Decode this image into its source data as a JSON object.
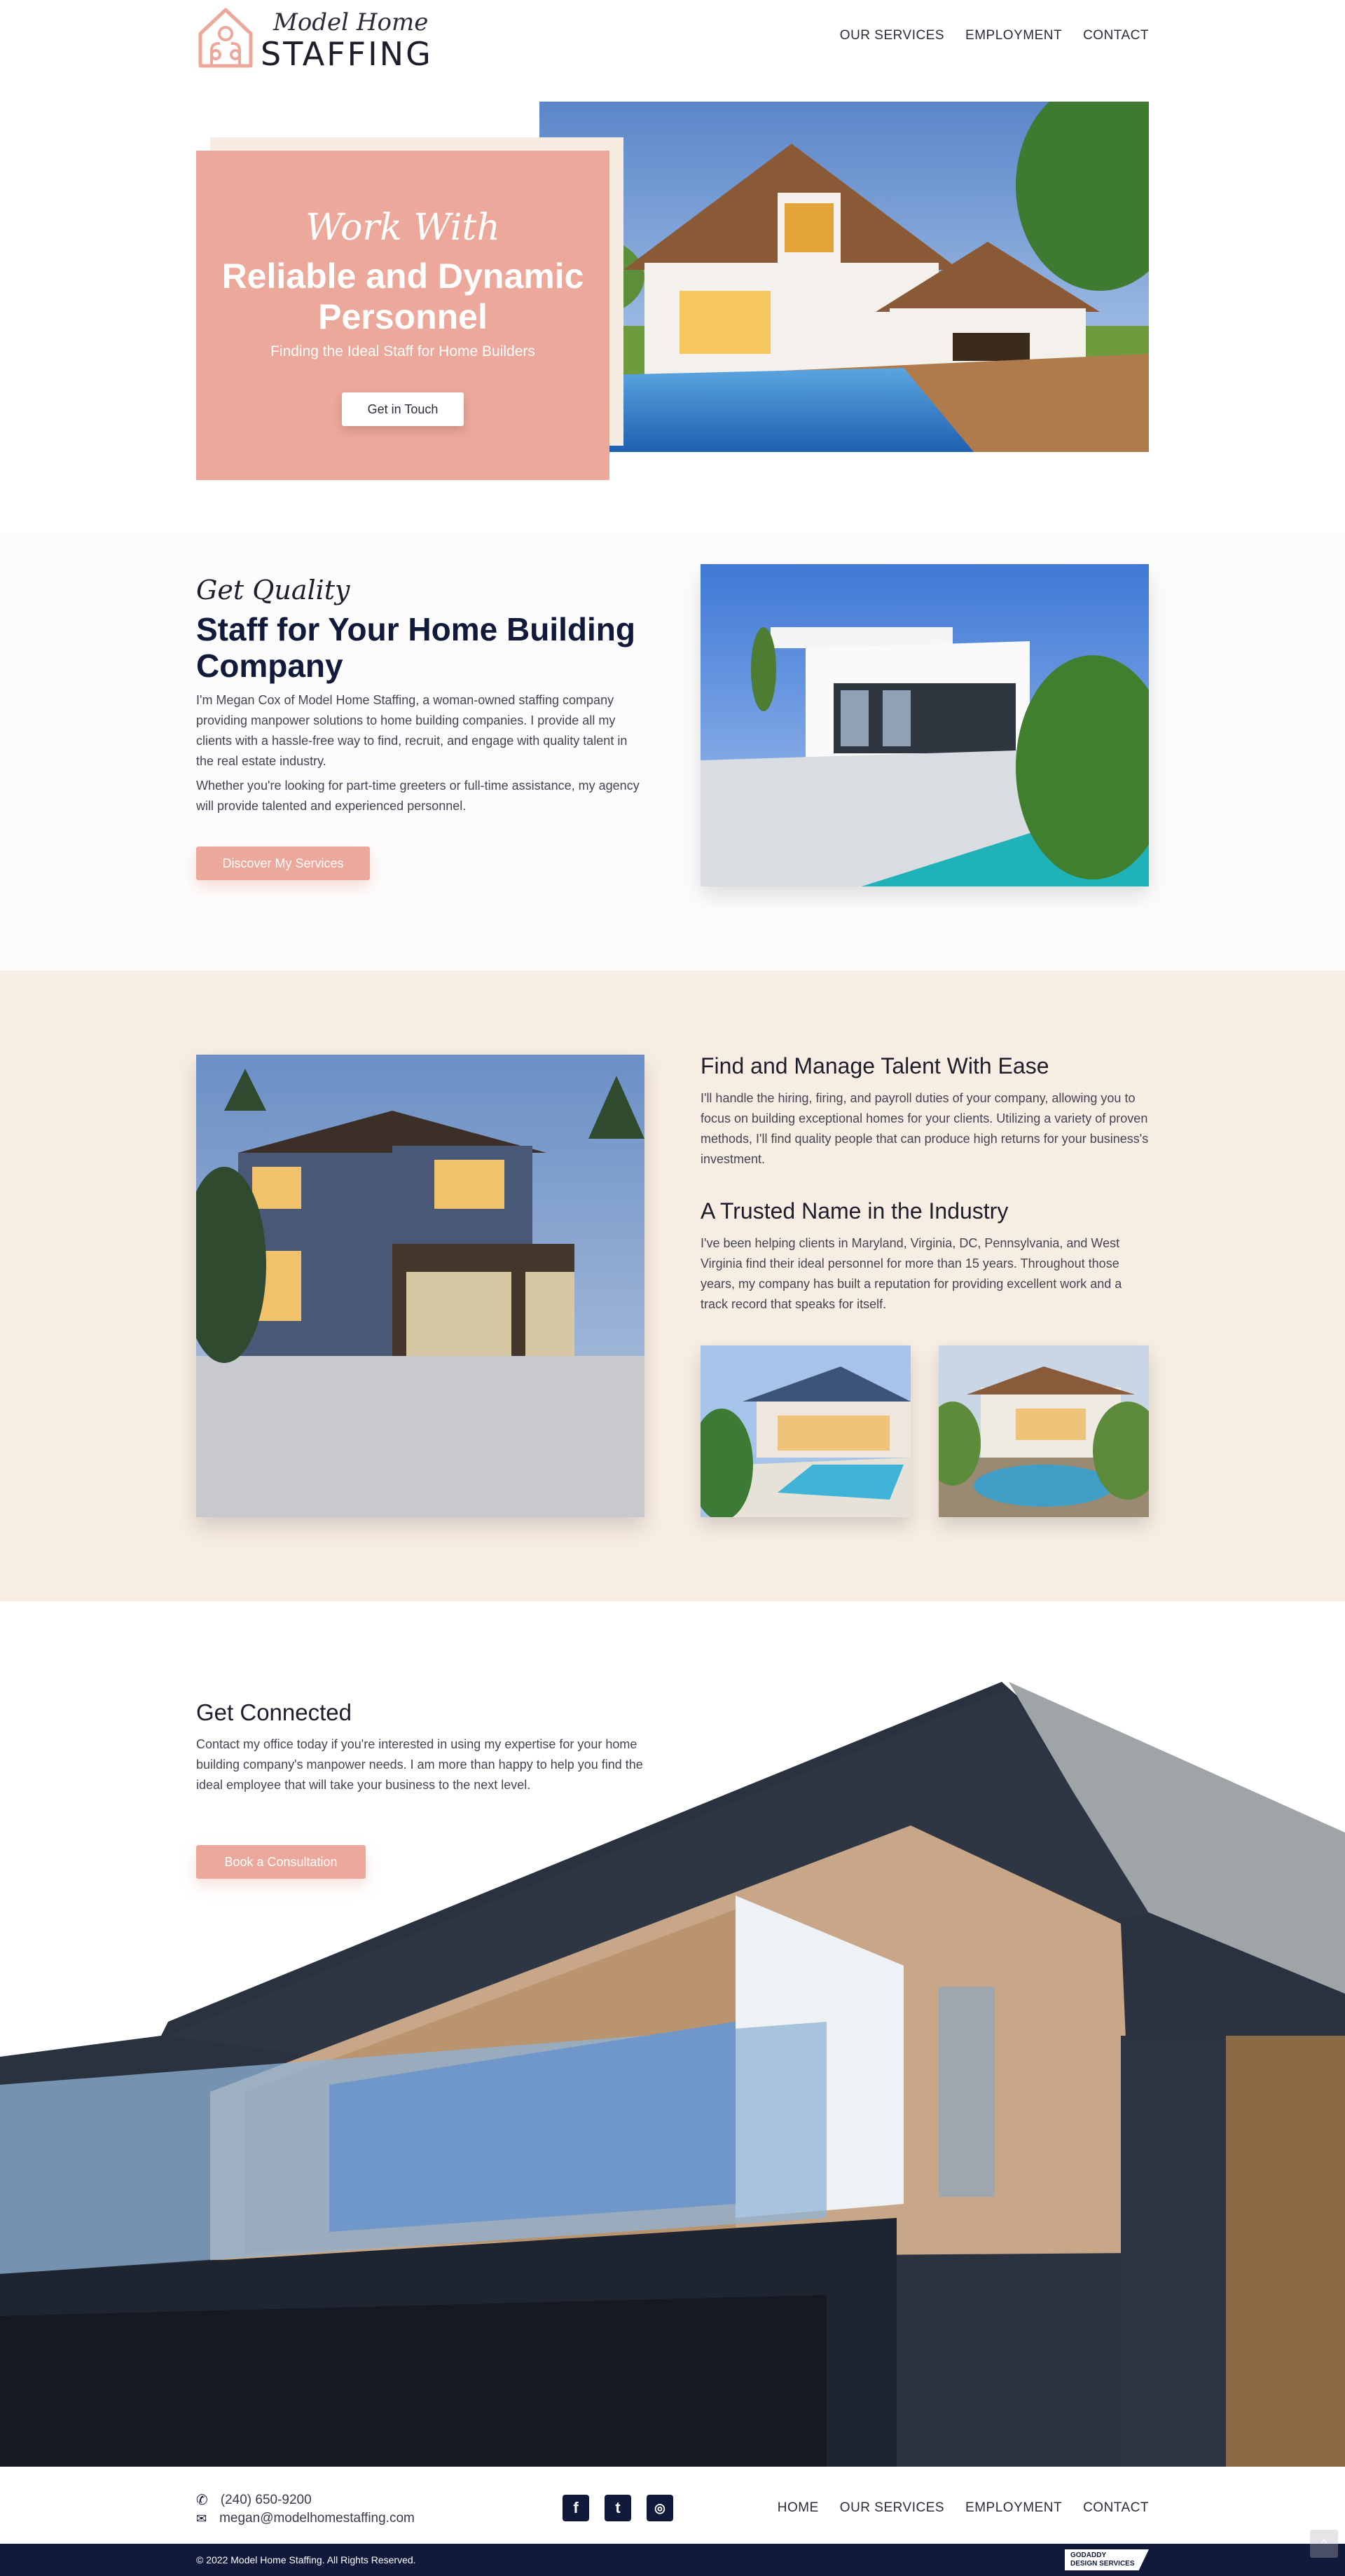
{
  "header": {
    "logo_script": "Model Home",
    "logo_word": "STAFFING",
    "nav": [
      "OUR SERVICES",
      "EMPLOYMENT",
      "CONTACT"
    ]
  },
  "hero": {
    "script": "Work With",
    "title": "Reliable and Dynamic Personnel",
    "subtitle": "Finding the Ideal Staff for Home Builders",
    "button": "Get in Touch"
  },
  "about": {
    "script": "Get Quality",
    "title": "Staff for Your Home Building Company",
    "p1": "I'm Megan Cox of Model Home Staffing, a woman-owned staffing company providing manpower solutions to home building companies. I provide all my clients with a hassle-free way to find, recruit, and engage with quality talent in the real estate industry.",
    "p2": "Whether you're looking for part-time greeters or full-time assistance, my agency will provide talented and experienced personnel.",
    "button": "Discover My Services"
  },
  "talent": {
    "h1": "Find and Manage Talent With Ease",
    "p1": "I'll handle the hiring, firing, and payroll duties of your company, allowing you to focus on building exceptional homes for your clients. Utilizing a variety of proven methods, I'll find quality people that can produce high returns for your business's investment.",
    "h2": "A Trusted Name in the Industry",
    "p2": "I've been helping clients in Maryland, Virginia, DC, Pennsylvania, and West Virginia find their ideal personnel for more than 15 years. Throughout those years, my company has built a reputation for providing excellent work and a track record that speaks for itself."
  },
  "connect": {
    "title": "Get Connected",
    "text": "Contact my office today if you're interested in using my expertise for your home building company's manpower needs. I am more than happy to help you find the ideal employee that will take your business to the next level.",
    "button": "Book a Consultation"
  },
  "footer": {
    "phone": "(240) 650-9200",
    "email": "megan@modelhomestaffing.com",
    "social": [
      "facebook-icon",
      "twitter-icon",
      "instagram-icon"
    ],
    "nav": [
      "HOME",
      "OUR SERVICES",
      "EMPLOYMENT",
      "CONTACT"
    ],
    "copyright": "© 2022 Model Home Staffing. All Rights Reserved.",
    "badge_line1": "GODADDY",
    "badge_line2": "DESIGN SERVICES"
  },
  "colors": {
    "accent": "#eca89a",
    "navy": "#111a3a",
    "cream": "#f8ede3"
  }
}
